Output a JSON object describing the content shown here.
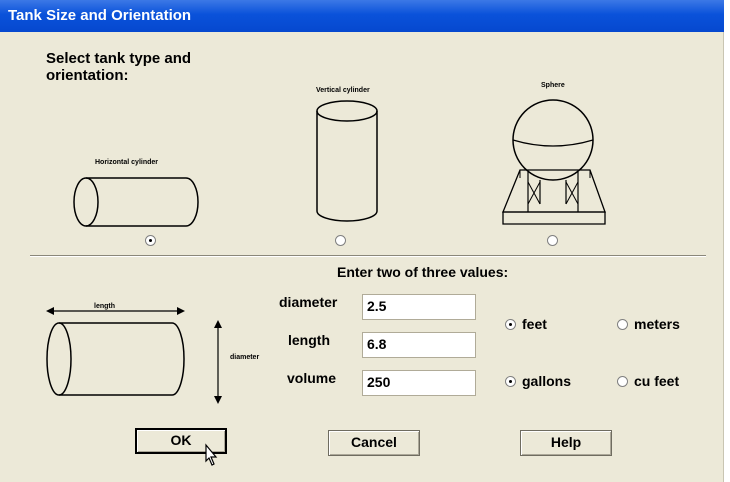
{
  "window": {
    "title": "Tank Size and Orientation"
  },
  "tank_type": {
    "prompt": "Select tank type and orientation:",
    "options": [
      {
        "label": "Horizontal cylinder",
        "selected": true
      },
      {
        "label": "Vertical cylinder",
        "selected": false
      },
      {
        "label": "Sphere",
        "selected": false
      }
    ]
  },
  "values_section": {
    "title": "Enter two of three values:",
    "diagram": {
      "length_label": "length",
      "diameter_label": "diameter"
    },
    "fields": {
      "diameter": {
        "label": "diameter",
        "value": "2.5"
      },
      "length": {
        "label": "length",
        "value": "6.8"
      },
      "volume": {
        "label": "volume",
        "value": "250"
      }
    },
    "length_units": [
      {
        "label": "feet",
        "selected": true
      },
      {
        "label": "meters",
        "selected": false
      }
    ],
    "volume_units": [
      {
        "label": "gallons",
        "selected": true
      },
      {
        "label": "cu feet",
        "selected": false
      }
    ]
  },
  "buttons": {
    "ok": "OK",
    "cancel": "Cancel",
    "help": "Help"
  }
}
